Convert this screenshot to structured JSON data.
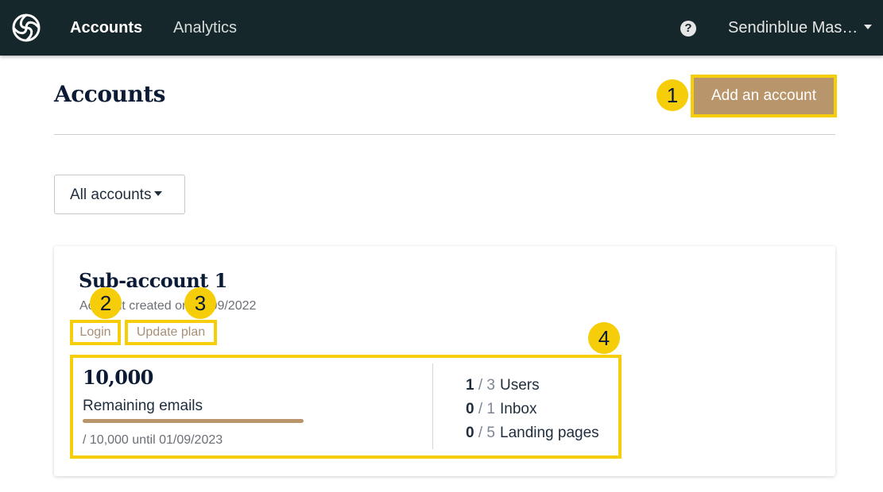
{
  "nav": {
    "logo_icon": "sendinblue-logo-icon",
    "items": [
      {
        "label": "Accounts",
        "active": true
      },
      {
        "label": "Analytics",
        "active": false
      }
    ],
    "help_icon": "question-circle-icon",
    "help_glyph": "?",
    "user_label": "Sendinblue Mas…"
  },
  "header": {
    "title": "Accounts",
    "add_button_label": "Add an account"
  },
  "filter": {
    "selected": "All accounts"
  },
  "annotations": {
    "badge_1": "1",
    "badge_2": "2",
    "badge_3": "3",
    "badge_4": "4",
    "highlight_color": "#f5cd08"
  },
  "account": {
    "name": "Sub-account 1",
    "created": "Account created on 01/09/2022",
    "login_label": "Login",
    "update_plan_label": "Update plan",
    "emails": {
      "remaining": "10,000",
      "label": "Remaining emails",
      "progress_fraction": 1.0,
      "subtitle": "/ 10,000 until 01/09/2023"
    },
    "limits": [
      {
        "used": "1",
        "sep": " / ",
        "limit": "3",
        "label": "Users"
      },
      {
        "used": "0",
        "sep": " / ",
        "limit": "1",
        "label": "Inbox"
      },
      {
        "used": "0",
        "sep": " / ",
        "limit": "5",
        "label": "Landing pages"
      }
    ]
  },
  "colors": {
    "topbar": "#16272b",
    "accent_button": "#b8956b",
    "heading": "#0b1a35"
  }
}
